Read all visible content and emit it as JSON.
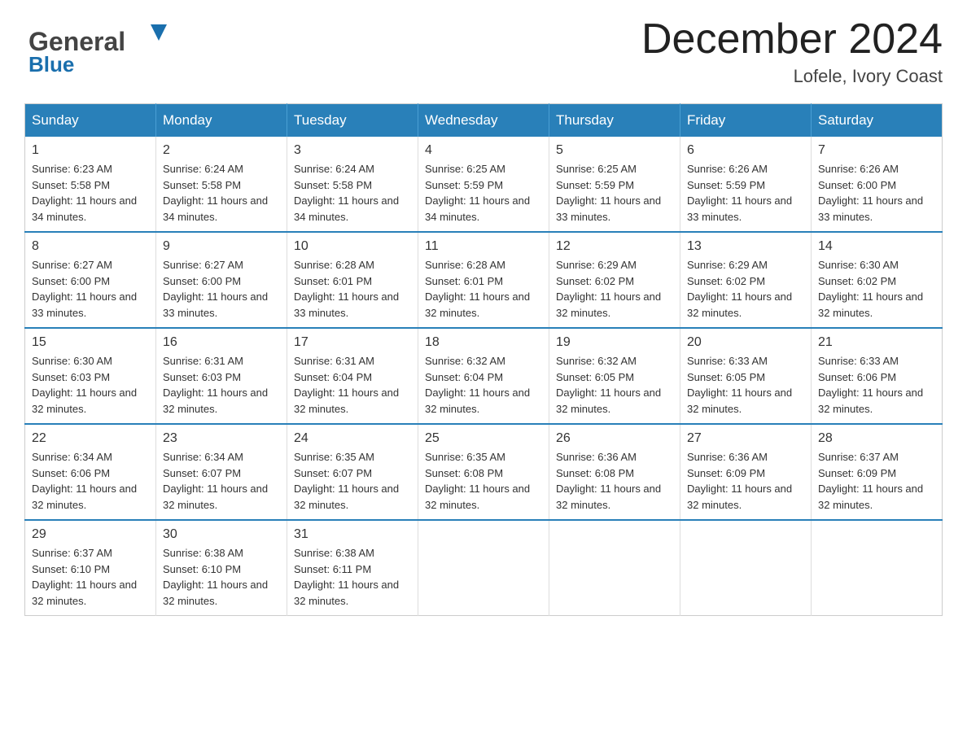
{
  "header": {
    "logo_general": "General",
    "logo_blue": "Blue",
    "month_title": "December 2024",
    "location": "Lofele, Ivory Coast"
  },
  "calendar": {
    "days_of_week": [
      "Sunday",
      "Monday",
      "Tuesday",
      "Wednesday",
      "Thursday",
      "Friday",
      "Saturday"
    ],
    "weeks": [
      [
        {
          "date": "1",
          "sunrise": "6:23 AM",
          "sunset": "5:58 PM",
          "daylight": "11 hours and 34 minutes."
        },
        {
          "date": "2",
          "sunrise": "6:24 AM",
          "sunset": "5:58 PM",
          "daylight": "11 hours and 34 minutes."
        },
        {
          "date": "3",
          "sunrise": "6:24 AM",
          "sunset": "5:58 PM",
          "daylight": "11 hours and 34 minutes."
        },
        {
          "date": "4",
          "sunrise": "6:25 AM",
          "sunset": "5:59 PM",
          "daylight": "11 hours and 34 minutes."
        },
        {
          "date": "5",
          "sunrise": "6:25 AM",
          "sunset": "5:59 PM",
          "daylight": "11 hours and 33 minutes."
        },
        {
          "date": "6",
          "sunrise": "6:26 AM",
          "sunset": "5:59 PM",
          "daylight": "11 hours and 33 minutes."
        },
        {
          "date": "7",
          "sunrise": "6:26 AM",
          "sunset": "6:00 PM",
          "daylight": "11 hours and 33 minutes."
        }
      ],
      [
        {
          "date": "8",
          "sunrise": "6:27 AM",
          "sunset": "6:00 PM",
          "daylight": "11 hours and 33 minutes."
        },
        {
          "date": "9",
          "sunrise": "6:27 AM",
          "sunset": "6:00 PM",
          "daylight": "11 hours and 33 minutes."
        },
        {
          "date": "10",
          "sunrise": "6:28 AM",
          "sunset": "6:01 PM",
          "daylight": "11 hours and 33 minutes."
        },
        {
          "date": "11",
          "sunrise": "6:28 AM",
          "sunset": "6:01 PM",
          "daylight": "11 hours and 32 minutes."
        },
        {
          "date": "12",
          "sunrise": "6:29 AM",
          "sunset": "6:02 PM",
          "daylight": "11 hours and 32 minutes."
        },
        {
          "date": "13",
          "sunrise": "6:29 AM",
          "sunset": "6:02 PM",
          "daylight": "11 hours and 32 minutes."
        },
        {
          "date": "14",
          "sunrise": "6:30 AM",
          "sunset": "6:02 PM",
          "daylight": "11 hours and 32 minutes."
        }
      ],
      [
        {
          "date": "15",
          "sunrise": "6:30 AM",
          "sunset": "6:03 PM",
          "daylight": "11 hours and 32 minutes."
        },
        {
          "date": "16",
          "sunrise": "6:31 AM",
          "sunset": "6:03 PM",
          "daylight": "11 hours and 32 minutes."
        },
        {
          "date": "17",
          "sunrise": "6:31 AM",
          "sunset": "6:04 PM",
          "daylight": "11 hours and 32 minutes."
        },
        {
          "date": "18",
          "sunrise": "6:32 AM",
          "sunset": "6:04 PM",
          "daylight": "11 hours and 32 minutes."
        },
        {
          "date": "19",
          "sunrise": "6:32 AM",
          "sunset": "6:05 PM",
          "daylight": "11 hours and 32 minutes."
        },
        {
          "date": "20",
          "sunrise": "6:33 AM",
          "sunset": "6:05 PM",
          "daylight": "11 hours and 32 minutes."
        },
        {
          "date": "21",
          "sunrise": "6:33 AM",
          "sunset": "6:06 PM",
          "daylight": "11 hours and 32 minutes."
        }
      ],
      [
        {
          "date": "22",
          "sunrise": "6:34 AM",
          "sunset": "6:06 PM",
          "daylight": "11 hours and 32 minutes."
        },
        {
          "date": "23",
          "sunrise": "6:34 AM",
          "sunset": "6:07 PM",
          "daylight": "11 hours and 32 minutes."
        },
        {
          "date": "24",
          "sunrise": "6:35 AM",
          "sunset": "6:07 PM",
          "daylight": "11 hours and 32 minutes."
        },
        {
          "date": "25",
          "sunrise": "6:35 AM",
          "sunset": "6:08 PM",
          "daylight": "11 hours and 32 minutes."
        },
        {
          "date": "26",
          "sunrise": "6:36 AM",
          "sunset": "6:08 PM",
          "daylight": "11 hours and 32 minutes."
        },
        {
          "date": "27",
          "sunrise": "6:36 AM",
          "sunset": "6:09 PM",
          "daylight": "11 hours and 32 minutes."
        },
        {
          "date": "28",
          "sunrise": "6:37 AM",
          "sunset": "6:09 PM",
          "daylight": "11 hours and 32 minutes."
        }
      ],
      [
        {
          "date": "29",
          "sunrise": "6:37 AM",
          "sunset": "6:10 PM",
          "daylight": "11 hours and 32 minutes."
        },
        {
          "date": "30",
          "sunrise": "6:38 AM",
          "sunset": "6:10 PM",
          "daylight": "11 hours and 32 minutes."
        },
        {
          "date": "31",
          "sunrise": "6:38 AM",
          "sunset": "6:11 PM",
          "daylight": "11 hours and 32 minutes."
        },
        null,
        null,
        null,
        null
      ]
    ]
  }
}
